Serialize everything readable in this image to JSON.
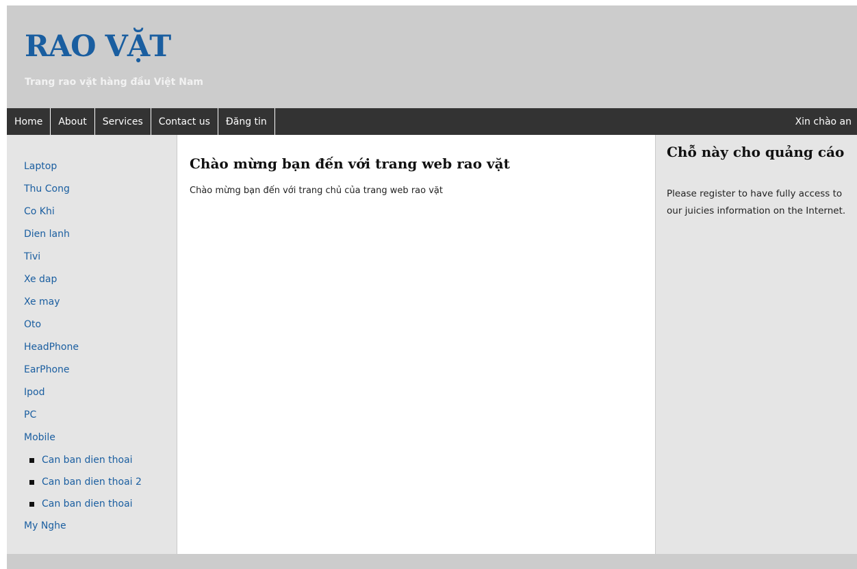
{
  "header": {
    "logo": "RAO VẶT",
    "tagline": "Trang rao vặt hàng đầu Việt Nam"
  },
  "nav": {
    "items": [
      {
        "label": "Home"
      },
      {
        "label": "About"
      },
      {
        "label": "Services"
      },
      {
        "label": "Contact us"
      },
      {
        "label": "Đăng tin"
      }
    ],
    "greeting": "Xin chào an"
  },
  "sidebar": {
    "categories": [
      {
        "label": "Laptop"
      },
      {
        "label": "Thu Cong"
      },
      {
        "label": "Co Khi"
      },
      {
        "label": "Dien lanh"
      },
      {
        "label": "Tivi"
      },
      {
        "label": "Xe dap"
      },
      {
        "label": "Xe may"
      },
      {
        "label": "Oto"
      },
      {
        "label": "HeadPhone"
      },
      {
        "label": "EarPhone"
      },
      {
        "label": "Ipod"
      },
      {
        "label": "PC"
      },
      {
        "label": "Mobile"
      }
    ],
    "mobile_subitems": [
      {
        "label": "Can ban dien thoai"
      },
      {
        "label": "Can ban dien thoai 2"
      },
      {
        "label": "Can ban dien thoai"
      }
    ],
    "last_category": {
      "label": "My Nghe"
    }
  },
  "main": {
    "title": "Chào mừng bạn đến với trang web rao vặt",
    "text": "Chào mừng bạn đến với trang chủ của trang web rao vặt"
  },
  "ad": {
    "title": "Chỗ này cho quảng cáo",
    "text": "Please register to have fully access to our juicies information on the Internet."
  },
  "colors": {
    "link": "#1a5ea0",
    "navbar": "#333333",
    "background": "#cccccc",
    "sidebar": "#e5e5e5"
  }
}
